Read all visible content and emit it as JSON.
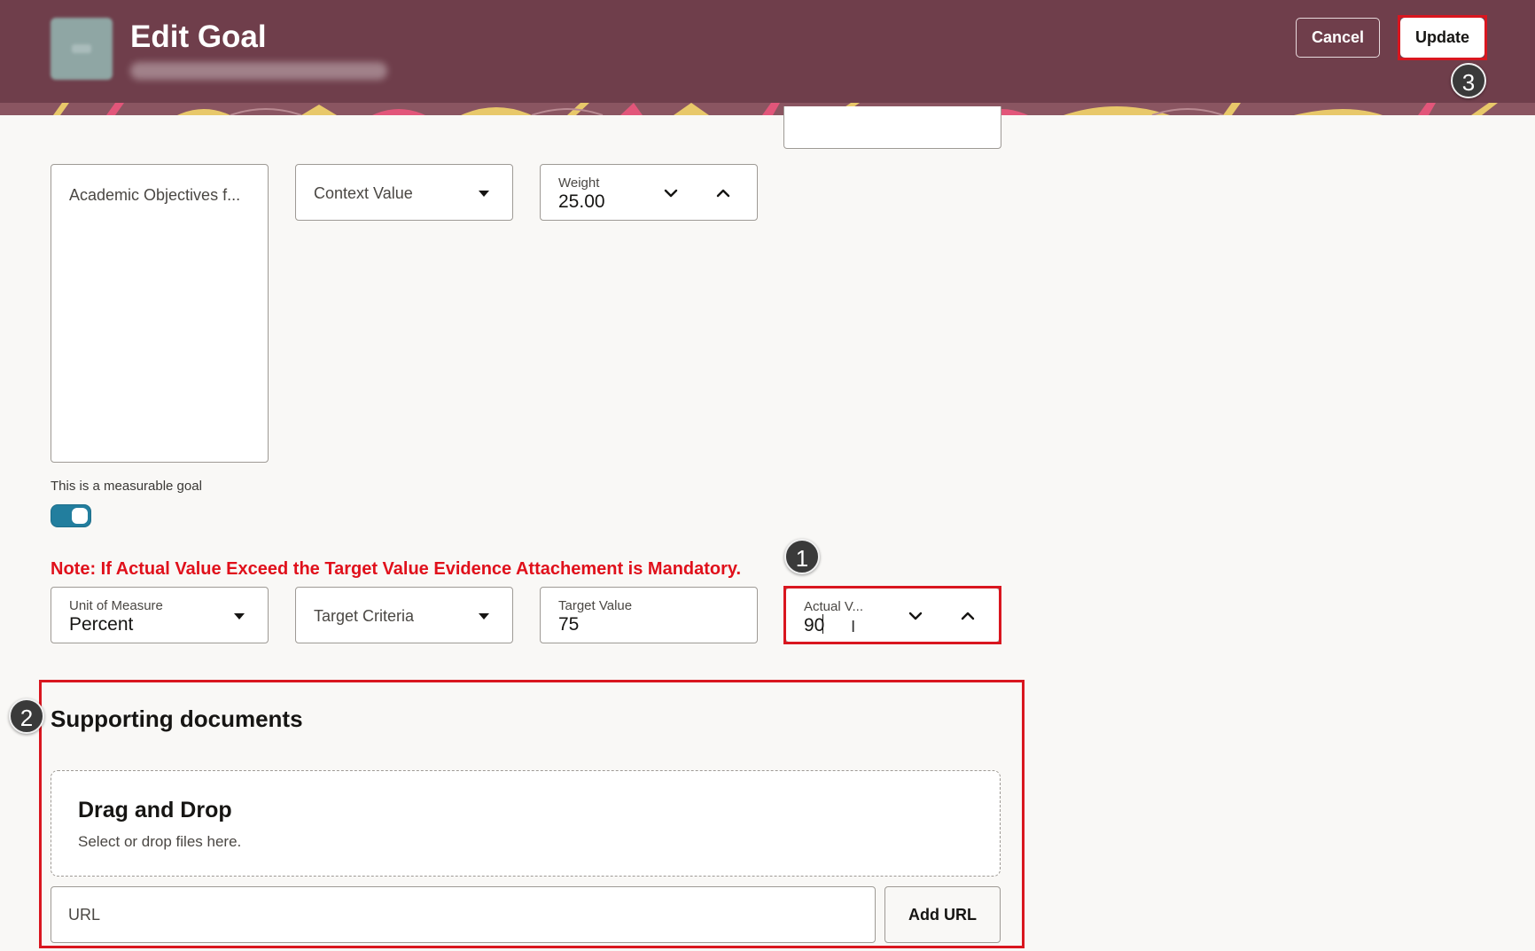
{
  "header": {
    "title": "Edit Goal",
    "cancel_label": "Cancel",
    "update_label": "Update"
  },
  "fields": {
    "goal_name_value": "Academic Objectives f...",
    "context_value_placeholder": "Context Value",
    "weight_label": "Weight",
    "weight_value": "25.00",
    "measurable_label": "This is a measurable goal",
    "measurable_on": true,
    "note": "Note: If Actual Value Exceed the Target Value Evidence Attachement is Mandatory.",
    "uom_label": "Unit of Measure",
    "uom_value": "Percent",
    "target_criteria_placeholder": "Target Criteria",
    "target_value_label": "Target Value",
    "target_value": "75",
    "actual_value_label": "Actual V...",
    "actual_value": "90"
  },
  "supporting_documents": {
    "title": "Supporting documents",
    "dropzone_title": "Drag and Drop",
    "dropzone_subtitle": "Select or drop files here.",
    "url_placeholder": "URL",
    "add_url_label": "Add URL"
  },
  "markers": {
    "step1": "1",
    "step2": "2",
    "step3": "3"
  },
  "colors": {
    "header_bg": "#6f3e4b",
    "highlight": "#d9161f",
    "note_red": "#e0101b",
    "toggle_on": "#227e9e"
  }
}
